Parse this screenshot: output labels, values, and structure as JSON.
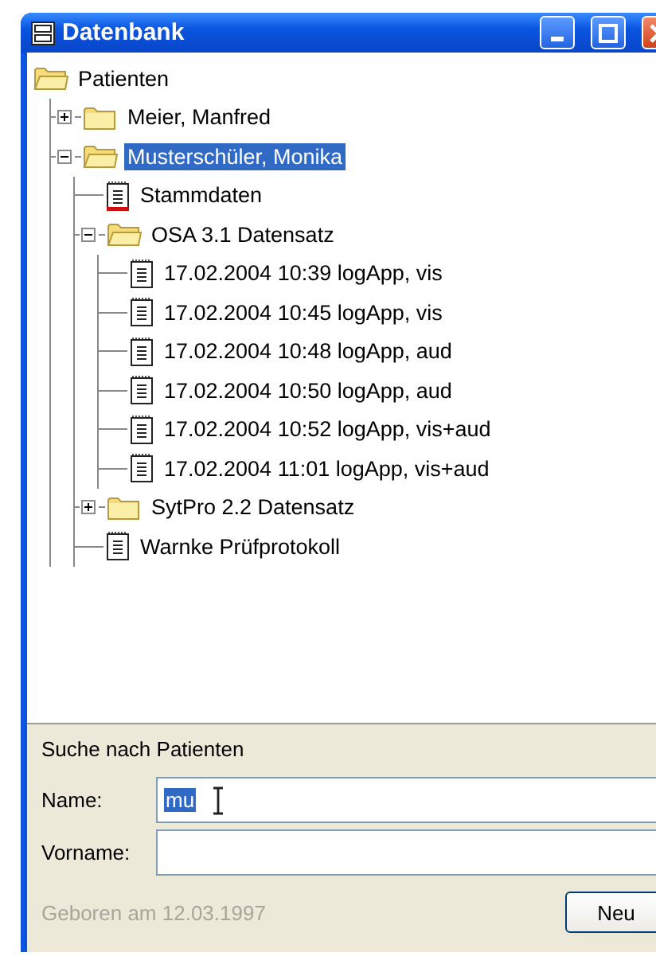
{
  "window": {
    "title": "Datenbank"
  },
  "tree": [
    {
      "label": "Patienten",
      "kind": "folder",
      "selected": false,
      "children": [
        {
          "label": "Meier, Manfred",
          "kind": "folder",
          "selected": false,
          "expanded": false
        },
        {
          "label": "Musterschüler, Monika",
          "kind": "folder",
          "selected": true,
          "expanded": true,
          "children": [
            {
              "label": "Stammdaten",
              "kind": "record",
              "selected": false
            },
            {
              "label": "OSA 3.1 Datensatz",
              "kind": "folder",
              "selected": false,
              "expanded": true,
              "children": [
                {
                  "label": "17.02.2004 10:39 logApp, vis",
                  "kind": "document",
                  "selected": false
                },
                {
                  "label": "17.02.2004 10:45 logApp, vis",
                  "kind": "document",
                  "selected": false
                },
                {
                  "label": "17.02.2004 10:48 logApp, aud",
                  "kind": "document",
                  "selected": false
                },
                {
                  "label": "17.02.2004 10:50 logApp, aud",
                  "kind": "document",
                  "selected": false
                },
                {
                  "label": "17.02.2004 10:52 logApp, vis+aud",
                  "kind": "document",
                  "selected": false
                },
                {
                  "label": "17.02.2004 11:01 logApp, vis+aud",
                  "kind": "document",
                  "selected": false
                }
              ]
            },
            {
              "label": "SytPro 2.2 Datensatz",
              "kind": "folder",
              "selected": false,
              "expanded": false
            },
            {
              "label": "Warnke Prüfprotokoll",
              "kind": "document",
              "selected": false
            }
          ]
        }
      ]
    }
  ],
  "search": {
    "heading": "Suche nach Patienten",
    "fields": [
      {
        "label": "Name:",
        "value": "mu",
        "text_selected": true
      },
      {
        "label": "Vorname:"
      }
    ],
    "birth_note": "Geboren am 12.03.1997",
    "button": "Neu"
  }
}
